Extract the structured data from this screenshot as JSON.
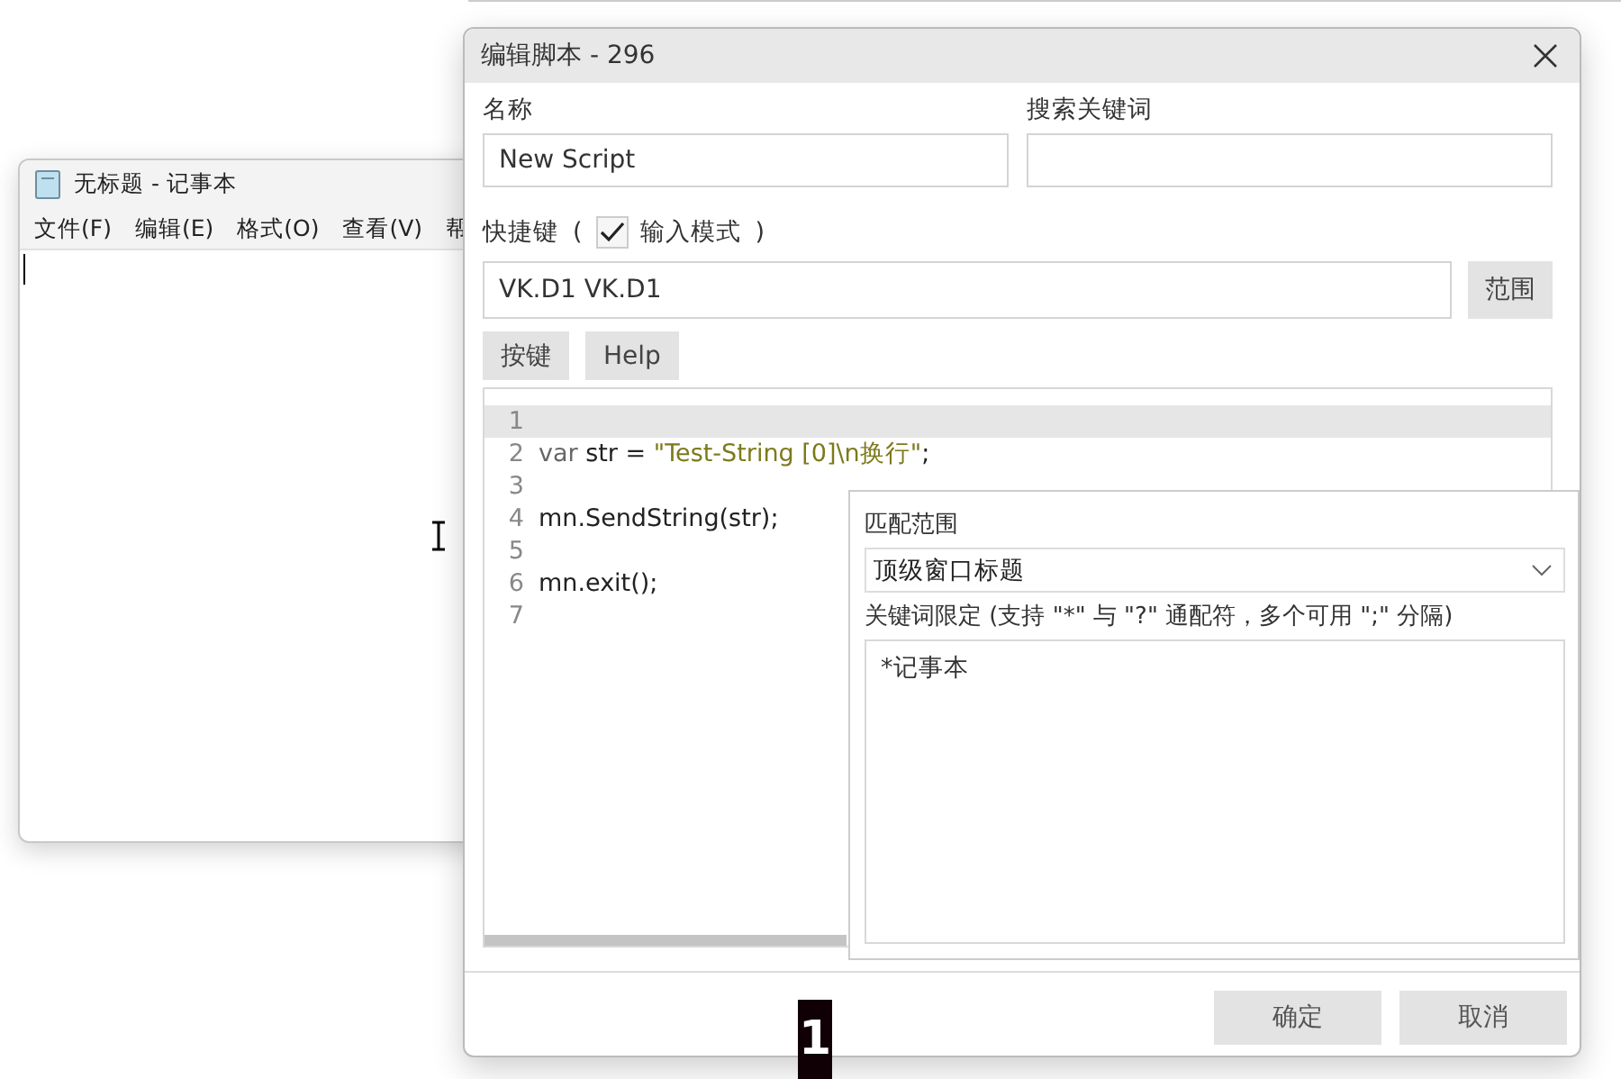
{
  "notepad": {
    "title": "无标题 - 记事本",
    "menu": [
      "文件(F)",
      "编辑(E)",
      "格式(O)",
      "查看(V)",
      "帮"
    ]
  },
  "dialog": {
    "title": "编辑脚本 - 296",
    "name": {
      "label": "名称",
      "value": "New Script"
    },
    "keyword": {
      "label": "搜索关键词"
    },
    "hotkey": {
      "label": "快捷键",
      "open_paren": "(",
      "close_paren": ")",
      "input_mode": {
        "label": "输入模式",
        "checked": true
      },
      "value": "VK.D1 VK.D1",
      "range_button": "范围"
    },
    "tool_buttons": [
      "按键",
      "Help"
    ],
    "code_lines": [
      {
        "number": "1",
        "current": true
      },
      {
        "number": "2",
        "current": false,
        "tokens": [
          {
            "kind": "keyword",
            "text": "var"
          },
          {
            "kind": "plain",
            "text": " str = "
          },
          {
            "kind": "string",
            "text": "\"Test-String [0]\\n换行\""
          },
          {
            "kind": "plain",
            "text": ";"
          }
        ]
      },
      {
        "number": "3",
        "current": false
      },
      {
        "number": "4",
        "current": false,
        "tokens": [
          {
            "kind": "plain",
            "text": "mn.SendString(str);"
          }
        ]
      },
      {
        "number": "5",
        "current": false
      },
      {
        "number": "6",
        "current": false,
        "tokens": [
          {
            "kind": "plain",
            "text": "mn.exit();"
          }
        ]
      },
      {
        "number": "7",
        "current": false
      }
    ],
    "match_panel": {
      "title": "匹配范围",
      "scope": "顶级窗口标题",
      "hint": "关键词限定 (支持 \"*\" 与 \"?\" 通配符，多个可用 \";\" 分隔)",
      "keywords": "*记事本"
    },
    "footer_buttons": [
      "确定",
      "取消"
    ]
  },
  "key_overlay": "1"
}
